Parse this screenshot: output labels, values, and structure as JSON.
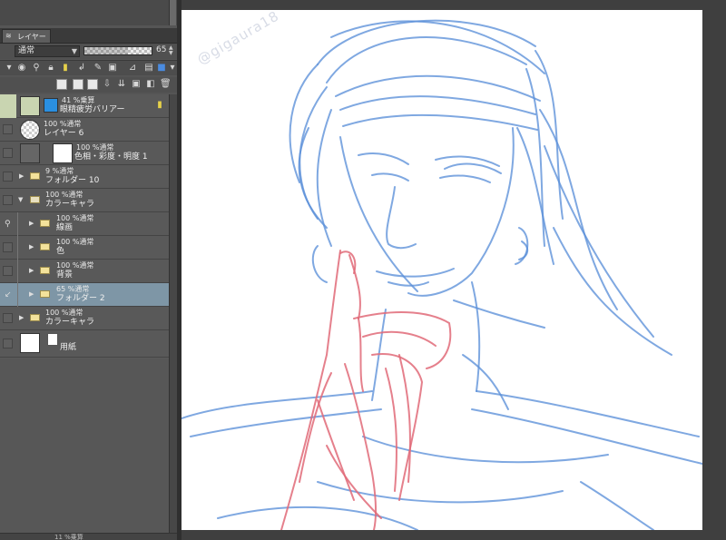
{
  "panel": {
    "tab_label": "レイヤー",
    "blend_mode": "通常",
    "opacity_value": "65",
    "opacity_fraction": 0.65,
    "footer_text": "11 %乗算"
  },
  "layers": [
    {
      "l1": "41 %乗算",
      "l2": "眼精疲労バリアー"
    },
    {
      "l1": "100 %通常",
      "l2": "レイヤー 6"
    },
    {
      "l1": "100 %通常",
      "l2": "色相・彩度・明度 1"
    },
    {
      "l1": "9 %通常",
      "l2": "フォルダー 10"
    },
    {
      "l1": "100 %通常",
      "l2": "カラーキャラ"
    },
    {
      "l1": "100 %通常",
      "l2": "線画"
    },
    {
      "l1": "100 %通常",
      "l2": "色"
    },
    {
      "l1": "100 %通常",
      "l2": "背景"
    },
    {
      "l1": "65 %通常",
      "l2": "フォルダー 2"
    },
    {
      "l1": "100 %通常",
      "l2": "カラーキャラ"
    },
    {
      "l1": "",
      "l2": "用紙"
    }
  ],
  "canvas": {
    "watermark": "@gigaura18",
    "sketch_blue": "#5b8fd8",
    "sketch_red": "#e06a78",
    "selected_layer_color": "#7e96a6"
  },
  "icons": {
    "tab": "layers-icon",
    "expand": "triangle-right-icon",
    "collapse": "triangle-down-icon",
    "folder": "folder-icon",
    "paper": "paper-icon"
  }
}
